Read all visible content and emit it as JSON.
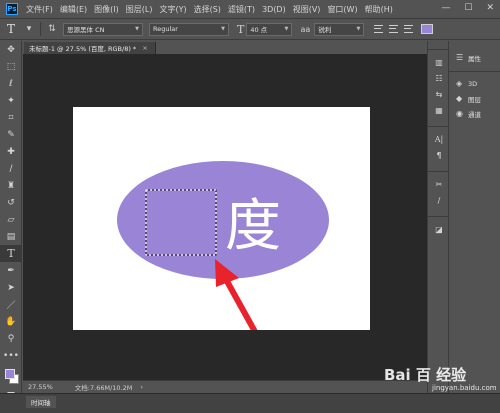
{
  "menubar": {
    "logo": "Ps",
    "items": [
      "文件(F)",
      "编辑(E)",
      "图像(I)",
      "图层(L)",
      "文字(Y)",
      "选择(S)",
      "滤镜(T)",
      "3D(D)",
      "视图(V)",
      "窗口(W)",
      "帮助(H)"
    ],
    "min": "—",
    "max": "☐",
    "close": "✕"
  },
  "options": {
    "font_family": "思源黑体 CN",
    "font_style": "Regular",
    "font_size": "40 点",
    "antialias": "锐利",
    "text_color": "#9a84d6"
  },
  "document": {
    "tab_title": "未标题-1 @ 27.5% (百度, RGB/8) *",
    "tab_close": "×",
    "canvas_text": "度",
    "ellipse_color": "#9a84d6",
    "arrow_color": "#e8232c"
  },
  "status": {
    "zoom": "27.55%",
    "doc_size": "文档:7.66M/10.2M",
    "more": "›"
  },
  "timeline": {
    "tab_label": "时间轴"
  },
  "panels": {
    "items": [
      {
        "icon": "☰",
        "label": "属性"
      },
      {
        "icon": "◈",
        "label": "3D"
      },
      {
        "icon": "◆",
        "label": "图层"
      },
      {
        "icon": "◉",
        "label": "通道"
      }
    ]
  },
  "colors": {
    "foreground": "#9a84d6",
    "background": "#ffffff"
  },
  "watermark": {
    "text": "Bai 百 经验",
    "url": "jingyan.baidu.com"
  }
}
